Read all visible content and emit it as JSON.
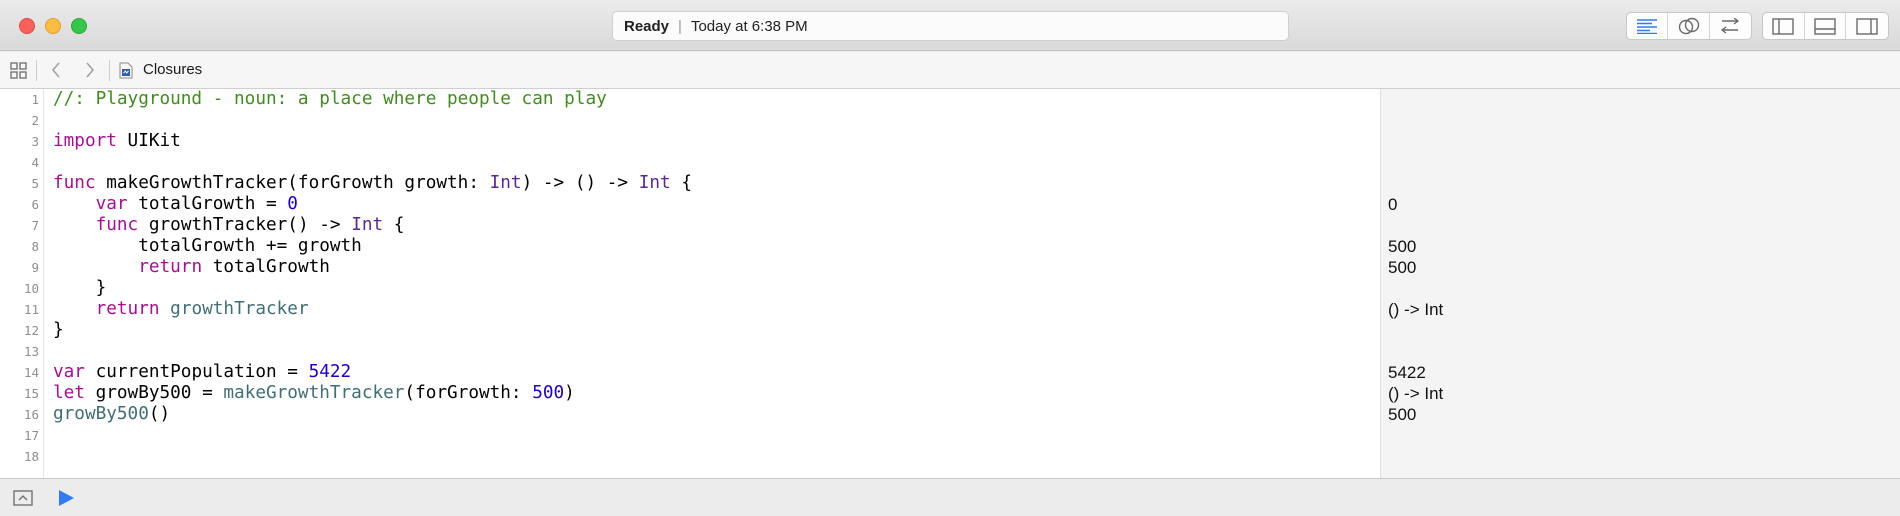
{
  "window": {
    "status": {
      "state": "Ready",
      "time": "Today at 6:38 PM"
    },
    "toolbar_icons": [
      "standard-editor-icon",
      "assistant-editor-icon",
      "version-editor-icon",
      "navigator-toggle-icon",
      "debug-area-toggle-icon",
      "utilities-toggle-icon"
    ]
  },
  "jumpbar": {
    "file_name": "Closures"
  },
  "editor": {
    "lines": [
      {
        "n": "1",
        "result": ""
      },
      {
        "n": "2",
        "result": ""
      },
      {
        "n": "3",
        "result": ""
      },
      {
        "n": "4",
        "result": ""
      },
      {
        "n": "5",
        "result": ""
      },
      {
        "n": "6",
        "result": "0"
      },
      {
        "n": "7",
        "result": ""
      },
      {
        "n": "8",
        "result": "500"
      },
      {
        "n": "9",
        "result": "500"
      },
      {
        "n": "10",
        "result": ""
      },
      {
        "n": "11",
        "result": "() -> Int"
      },
      {
        "n": "12",
        "result": ""
      },
      {
        "n": "13",
        "result": ""
      },
      {
        "n": "14",
        "result": "5422"
      },
      {
        "n": "15",
        "result": "() -> Int"
      },
      {
        "n": "16",
        "result": "500"
      },
      {
        "n": "17",
        "result": ""
      },
      {
        "n": "18",
        "result": ""
      }
    ],
    "code": {
      "l1": "//: Playground - noun: a place where people can play",
      "l3a": "import",
      "l3b": " UIKit",
      "l5a": "func",
      "l5b": " makeGrowthTracker(forGrowth growth: ",
      "l5c": "Int",
      "l5d": ") -> () -> ",
      "l5e": "Int",
      "l5f": " {",
      "l6a": "    ",
      "l6b": "var",
      "l6c": " totalGrowth = ",
      "l6d": "0",
      "l7a": "    ",
      "l7b": "func",
      "l7c": " growthTracker() -> ",
      "l7d": "Int",
      "l7e": " {",
      "l8": "        totalGrowth += growth",
      "l9a": "        ",
      "l9b": "return",
      "l9c": " totalGrowth",
      "l10": "    }",
      "l11a": "    ",
      "l11b": "return",
      "l11c": " ",
      "l11d": "growthTracker",
      "l12": "}",
      "l14a": "var",
      "l14b": " currentPopulation = ",
      "l14c": "5422",
      "l15a": "let",
      "l15b": " growBy500 = ",
      "l15c": "makeGrowthTracker",
      "l15d": "(forGrowth: ",
      "l15e": "500",
      "l15f": ")",
      "l16a": "growBy500",
      "l16b": "()"
    }
  },
  "colors": {
    "keyword": "#aa0d91",
    "type": "#5c2699",
    "number": "#1c00cf",
    "comment": "#3f8d1b",
    "identifier": "#3f6e74"
  }
}
